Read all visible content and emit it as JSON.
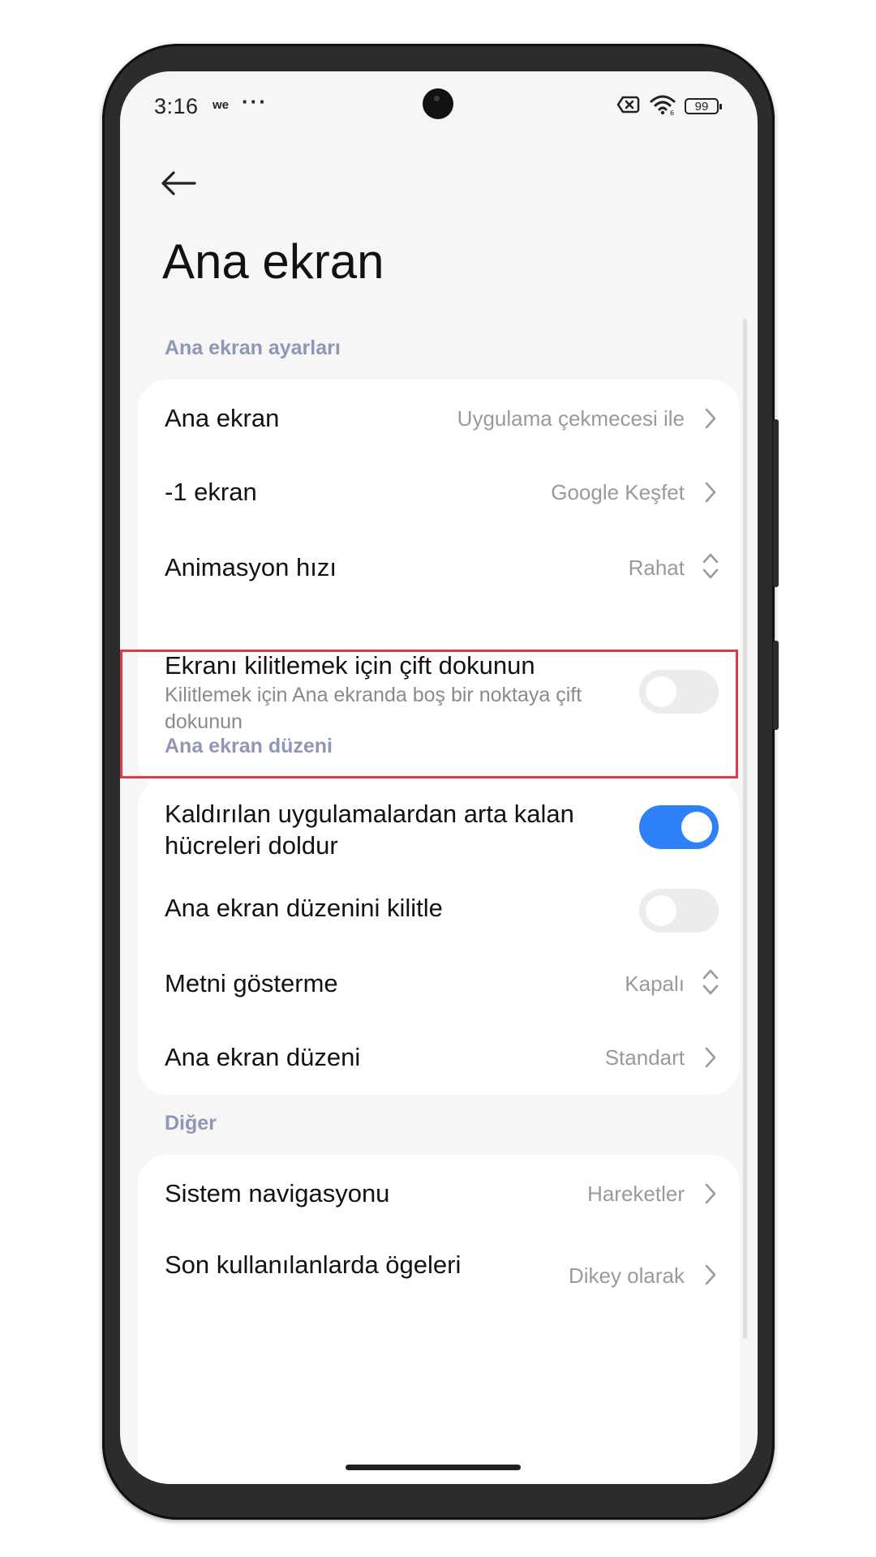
{
  "status_bar": {
    "time": "3:16",
    "carrier": "we",
    "dots": "···",
    "battery": "99",
    "icons": [
      "no-sim-icon",
      "wifi-icon",
      "battery-icon"
    ]
  },
  "header": {
    "back_icon": "back-arrow-icon",
    "title": "Ana ekran"
  },
  "sections": {
    "home_settings": {
      "header": "Ana ekran ayarları",
      "home_screen": {
        "label": "Ana ekran",
        "value": "Uygulama çekmecesi ile"
      },
      "minus_one": {
        "label": "-1 ekran",
        "value": "Google Keşfet"
      },
      "animation": {
        "label": "Animasyon hızı",
        "value": "Rahat"
      },
      "double_tap": {
        "label": "Ekranı kilitlemek için çift dokunun",
        "desc": "Kilitlemek için Ana ekranda boş bir noktaya çift dokunun",
        "enabled": false
      }
    },
    "layout": {
      "header": "Ana ekran düzeni",
      "fill_cells": {
        "label": "Kaldırılan uygulamalardan arta kalan hücreleri doldur",
        "enabled": true
      },
      "lock_layout": {
        "label": "Ana ekran düzenini kilitle",
        "enabled": false
      },
      "hide_text": {
        "label": "Metni gösterme",
        "value": "Kapalı"
      },
      "layout_type": {
        "label": "Ana ekran düzeni",
        "value": "Standart"
      }
    },
    "other": {
      "header": "Diğer",
      "navigation": {
        "label": "Sistem navigasyonu",
        "value": "Hareketler"
      },
      "recents": {
        "label": "Son kullanılanlarda ögeleri",
        "value": "Dikey olarak"
      }
    }
  },
  "colors": {
    "accent": "#2e81f8",
    "section_header": "#8e97b5",
    "highlight": "#e03a4b",
    "background": "#f6f6f6"
  }
}
